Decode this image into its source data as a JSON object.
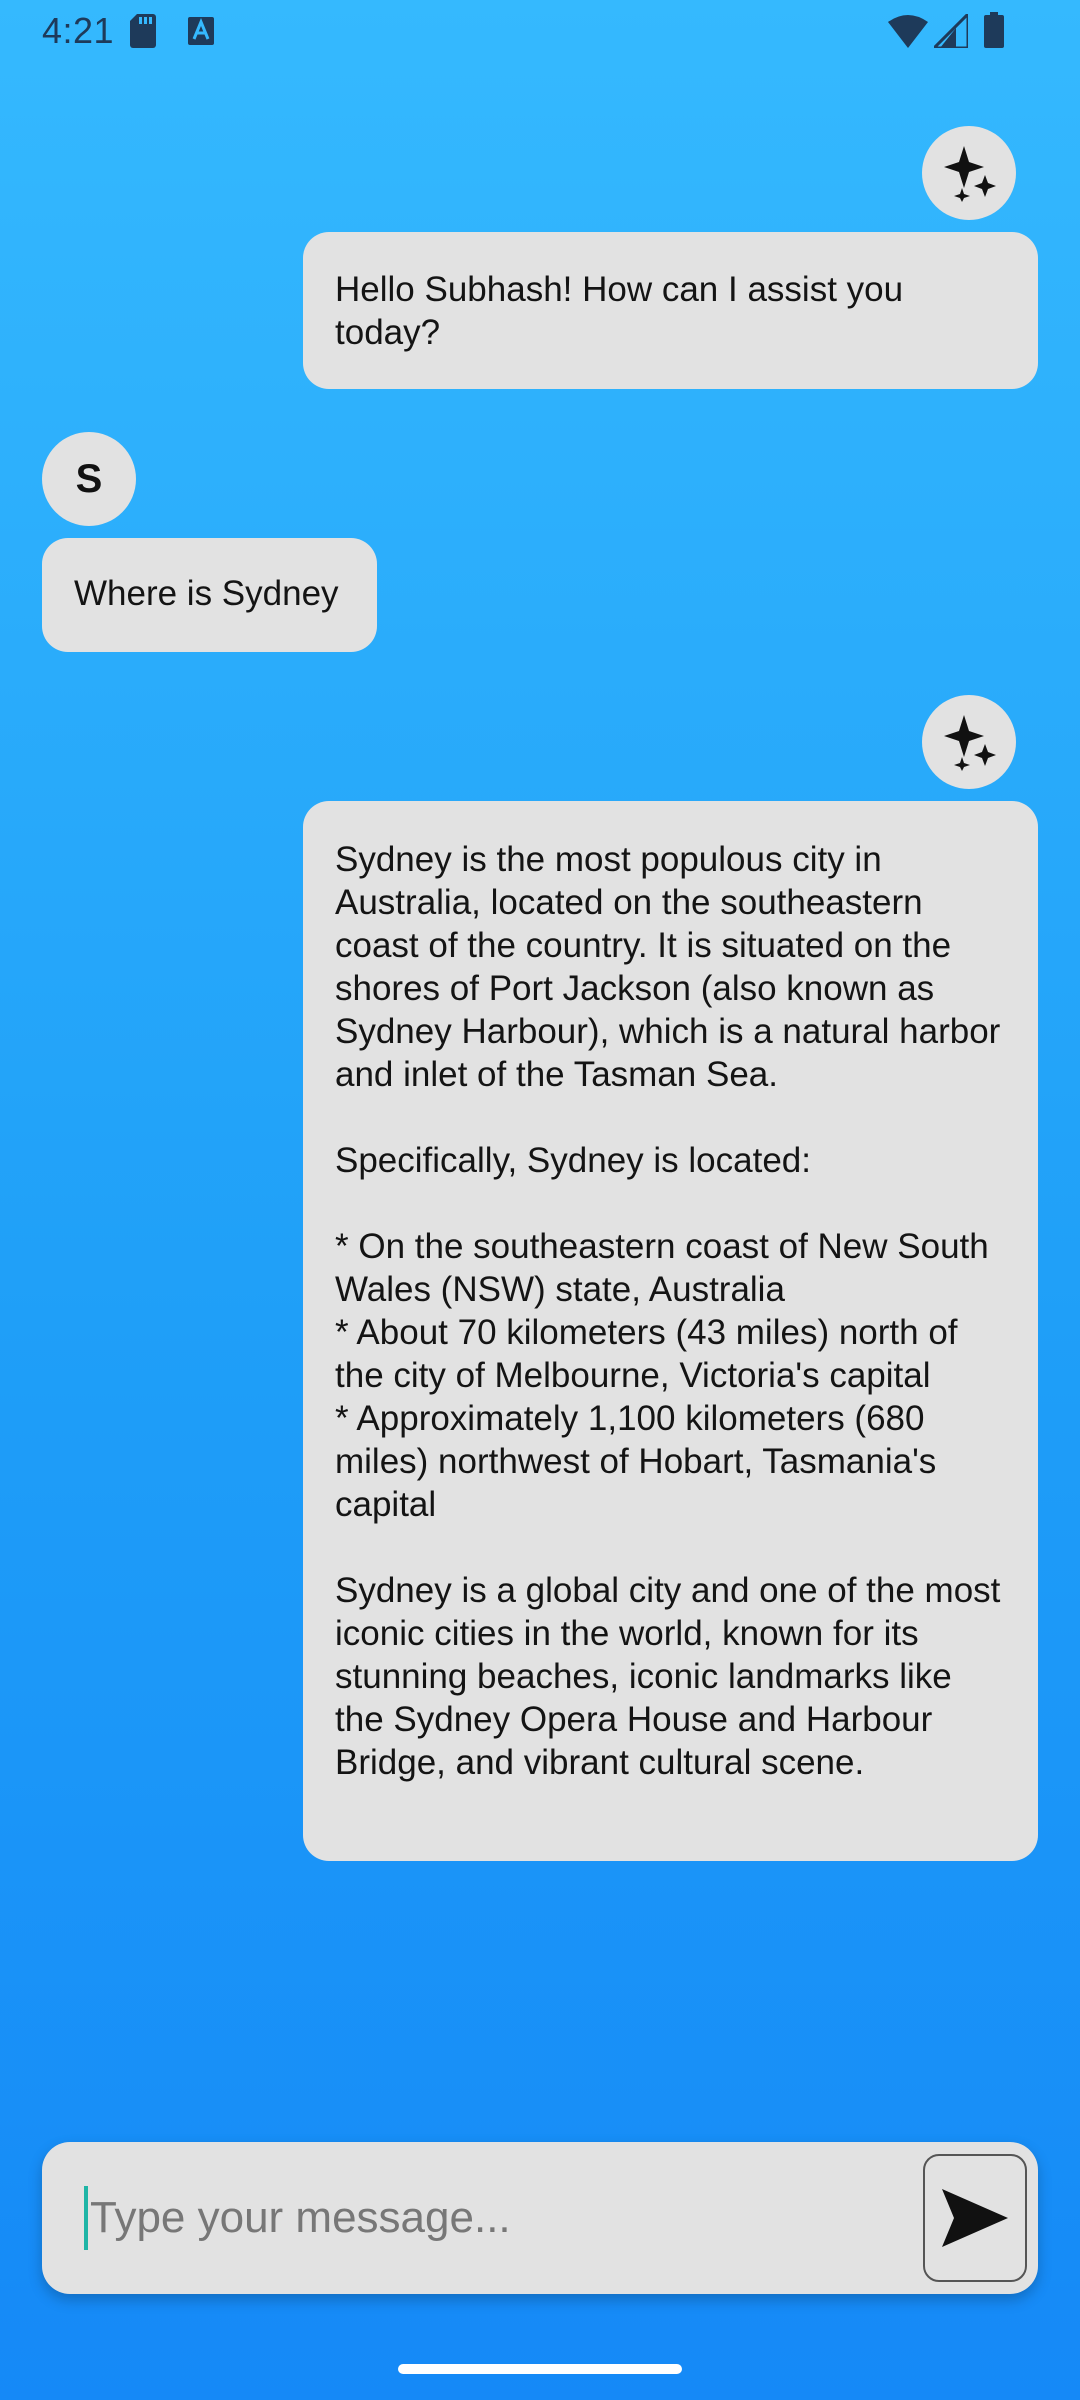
{
  "status_bar": {
    "time": "4:21",
    "left_icons": [
      "sd-card-icon",
      "keyboard-a-icon"
    ],
    "right_icons": [
      "wifi-icon",
      "signal-icon",
      "battery-icon"
    ]
  },
  "messages": [
    {
      "sender": "ai",
      "avatar_icon": "sparkle-icon",
      "text": "Hello Subhash! How can I assist you today?"
    },
    {
      "sender": "user",
      "avatar_letter": "S",
      "text": "Where is Sydney"
    },
    {
      "sender": "ai",
      "avatar_icon": "sparkle-icon",
      "text": "Sydney is the most populous city in Australia, located on the southeastern coast of the country. It is situated on the shores of Port Jackson (also known as Sydney Harbour), which is a natural harbor and inlet of the Tasman Sea.\n\nSpecifically, Sydney is located:\n\n* On the southeastern coast of New South Wales (NSW) state, Australia\n* About 70 kilometers (43 miles) north of the city of Melbourne, Victoria's capital\n* Approximately 1,100 kilometers (680 miles) northwest of Hobart, Tasmania's capital\n\nSydney is a global city and one of the most iconic cities in the world, known for its stunning beaches, iconic landmarks like the Sydney Opera House and Harbour Bridge, and vibrant cultural scene."
    }
  ],
  "input": {
    "placeholder": "Type your message...",
    "value": "",
    "send_icon": "send-icon"
  },
  "colors": {
    "background_top": "#35b9fe",
    "background_bottom": "#1589f7",
    "bubble": "#e2e2e2",
    "caret": "#1fb5a6"
  }
}
